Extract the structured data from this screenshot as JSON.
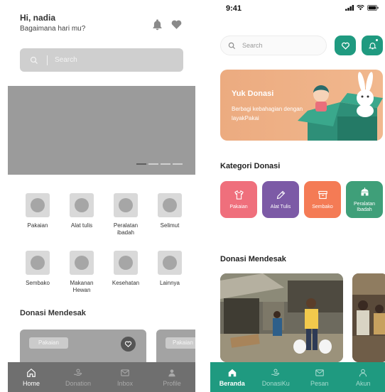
{
  "wireframe": {
    "greeting": "Hi, nadia",
    "subtitle": "Bagaimana hari mu?",
    "header_icons": [
      "bell-icon",
      "heart-icon"
    ],
    "search": {
      "placeholder": "Search"
    },
    "banner": {
      "carousel_pages": 4,
      "active_page": 1
    },
    "categories": [
      {
        "label": "Pakaian"
      },
      {
        "label": "Alat tulis"
      },
      {
        "label": "Peralatan ibadah"
      },
      {
        "label": "Selimut"
      },
      {
        "label": "Sembako"
      },
      {
        "label": "Makanan Hewan"
      },
      {
        "label": "Kesehatan"
      },
      {
        "label": "Lainnya"
      }
    ],
    "urgent_title": "Donasi Mendesak",
    "cards": [
      {
        "tag": "Pakaian"
      },
      {
        "tag": "Pakaian"
      }
    ],
    "nav": [
      {
        "label": "Home",
        "icon": "home-icon",
        "active": true
      },
      {
        "label": "Donation",
        "icon": "donation-icon",
        "active": false
      },
      {
        "label": "Inbox",
        "icon": "mail-icon",
        "active": false
      },
      {
        "label": "Profile",
        "icon": "user-icon",
        "active": false
      }
    ],
    "colors": {
      "block": "#d9d9d9",
      "banner": "#9b9b9b",
      "nav": "#6f6f6f"
    }
  },
  "hifi": {
    "status_time": "9:41",
    "search": {
      "placeholder": "Search"
    },
    "banner": {
      "title": "Yuk Donasi",
      "description": "Berbagi kebahagian dengan layakPakai"
    },
    "category_title": "Kategori Donasi",
    "categories": [
      {
        "label": "Pakaian",
        "icon": "shirt-icon",
        "color": "#ef6f7c"
      },
      {
        "label": "Alat Tulis",
        "icon": "pencil-icon",
        "color": "#7c5aa6"
      },
      {
        "label": "Sembako",
        "icon": "box-icon",
        "color": "#f47b55"
      },
      {
        "label": "Peralatan Ibadah",
        "icon": "mosque-icon",
        "color": "#3f9f79"
      }
    ],
    "urgent_title": "Donasi Mendesak",
    "nav": [
      {
        "label": "Beranda",
        "icon": "home-icon",
        "active": true
      },
      {
        "label": "DonasiKu",
        "icon": "donation-icon",
        "active": false
      },
      {
        "label": "Pesan",
        "icon": "mail-icon",
        "active": false
      },
      {
        "label": "Akun",
        "icon": "user-icon",
        "active": false
      }
    ],
    "colors": {
      "primary": "#1f9a80",
      "banner": "#ecab80"
    }
  }
}
